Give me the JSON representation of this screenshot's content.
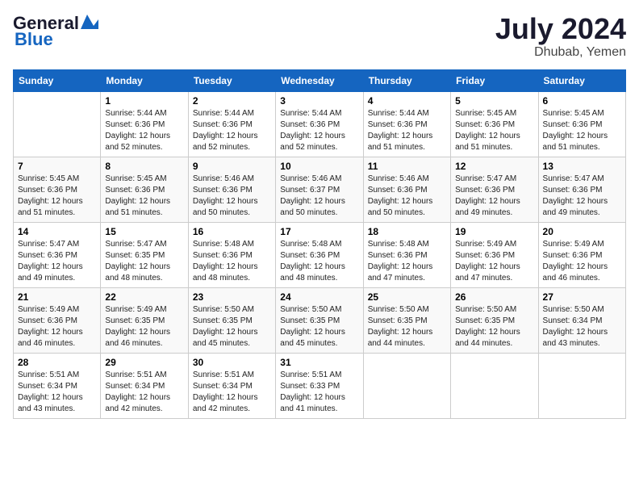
{
  "header": {
    "logo_line1": "General",
    "logo_line2": "Blue",
    "month_year": "July 2024",
    "location": "Dhubab, Yemen"
  },
  "weekdays": [
    "Sunday",
    "Monday",
    "Tuesday",
    "Wednesday",
    "Thursday",
    "Friday",
    "Saturday"
  ],
  "weeks": [
    [
      {
        "day": "",
        "sunrise": "",
        "sunset": "",
        "daylight": ""
      },
      {
        "day": "1",
        "sunrise": "Sunrise: 5:44 AM",
        "sunset": "Sunset: 6:36 PM",
        "daylight": "Daylight: 12 hours and 52 minutes."
      },
      {
        "day": "2",
        "sunrise": "Sunrise: 5:44 AM",
        "sunset": "Sunset: 6:36 PM",
        "daylight": "Daylight: 12 hours and 52 minutes."
      },
      {
        "day": "3",
        "sunrise": "Sunrise: 5:44 AM",
        "sunset": "Sunset: 6:36 PM",
        "daylight": "Daylight: 12 hours and 52 minutes."
      },
      {
        "day": "4",
        "sunrise": "Sunrise: 5:44 AM",
        "sunset": "Sunset: 6:36 PM",
        "daylight": "Daylight: 12 hours and 51 minutes."
      },
      {
        "day": "5",
        "sunrise": "Sunrise: 5:45 AM",
        "sunset": "Sunset: 6:36 PM",
        "daylight": "Daylight: 12 hours and 51 minutes."
      },
      {
        "day": "6",
        "sunrise": "Sunrise: 5:45 AM",
        "sunset": "Sunset: 6:36 PM",
        "daylight": "Daylight: 12 hours and 51 minutes."
      }
    ],
    [
      {
        "day": "7",
        "sunrise": "Sunrise: 5:45 AM",
        "sunset": "Sunset: 6:36 PM",
        "daylight": "Daylight: 12 hours and 51 minutes."
      },
      {
        "day": "8",
        "sunrise": "Sunrise: 5:45 AM",
        "sunset": "Sunset: 6:36 PM",
        "daylight": "Daylight: 12 hours and 51 minutes."
      },
      {
        "day": "9",
        "sunrise": "Sunrise: 5:46 AM",
        "sunset": "Sunset: 6:36 PM",
        "daylight": "Daylight: 12 hours and 50 minutes."
      },
      {
        "day": "10",
        "sunrise": "Sunrise: 5:46 AM",
        "sunset": "Sunset: 6:37 PM",
        "daylight": "Daylight: 12 hours and 50 minutes."
      },
      {
        "day": "11",
        "sunrise": "Sunrise: 5:46 AM",
        "sunset": "Sunset: 6:36 PM",
        "daylight": "Daylight: 12 hours and 50 minutes."
      },
      {
        "day": "12",
        "sunrise": "Sunrise: 5:47 AM",
        "sunset": "Sunset: 6:36 PM",
        "daylight": "Daylight: 12 hours and 49 minutes."
      },
      {
        "day": "13",
        "sunrise": "Sunrise: 5:47 AM",
        "sunset": "Sunset: 6:36 PM",
        "daylight": "Daylight: 12 hours and 49 minutes."
      }
    ],
    [
      {
        "day": "14",
        "sunrise": "Sunrise: 5:47 AM",
        "sunset": "Sunset: 6:36 PM",
        "daylight": "Daylight: 12 hours and 49 minutes."
      },
      {
        "day": "15",
        "sunrise": "Sunrise: 5:47 AM",
        "sunset": "Sunset: 6:35 PM",
        "daylight": "Daylight: 12 hours and 48 minutes."
      },
      {
        "day": "16",
        "sunrise": "Sunrise: 5:48 AM",
        "sunset": "Sunset: 6:36 PM",
        "daylight": "Daylight: 12 hours and 48 minutes."
      },
      {
        "day": "17",
        "sunrise": "Sunrise: 5:48 AM",
        "sunset": "Sunset: 6:36 PM",
        "daylight": "Daylight: 12 hours and 48 minutes."
      },
      {
        "day": "18",
        "sunrise": "Sunrise: 5:48 AM",
        "sunset": "Sunset: 6:36 PM",
        "daylight": "Daylight: 12 hours and 47 minutes."
      },
      {
        "day": "19",
        "sunrise": "Sunrise: 5:49 AM",
        "sunset": "Sunset: 6:36 PM",
        "daylight": "Daylight: 12 hours and 47 minutes."
      },
      {
        "day": "20",
        "sunrise": "Sunrise: 5:49 AM",
        "sunset": "Sunset: 6:36 PM",
        "daylight": "Daylight: 12 hours and 46 minutes."
      }
    ],
    [
      {
        "day": "21",
        "sunrise": "Sunrise: 5:49 AM",
        "sunset": "Sunset: 6:36 PM",
        "daylight": "Daylight: 12 hours and 46 minutes."
      },
      {
        "day": "22",
        "sunrise": "Sunrise: 5:49 AM",
        "sunset": "Sunset: 6:35 PM",
        "daylight": "Daylight: 12 hours and 46 minutes."
      },
      {
        "day": "23",
        "sunrise": "Sunrise: 5:50 AM",
        "sunset": "Sunset: 6:35 PM",
        "daylight": "Daylight: 12 hours and 45 minutes."
      },
      {
        "day": "24",
        "sunrise": "Sunrise: 5:50 AM",
        "sunset": "Sunset: 6:35 PM",
        "daylight": "Daylight: 12 hours and 45 minutes."
      },
      {
        "day": "25",
        "sunrise": "Sunrise: 5:50 AM",
        "sunset": "Sunset: 6:35 PM",
        "daylight": "Daylight: 12 hours and 44 minutes."
      },
      {
        "day": "26",
        "sunrise": "Sunrise: 5:50 AM",
        "sunset": "Sunset: 6:35 PM",
        "daylight": "Daylight: 12 hours and 44 minutes."
      },
      {
        "day": "27",
        "sunrise": "Sunrise: 5:50 AM",
        "sunset": "Sunset: 6:34 PM",
        "daylight": "Daylight: 12 hours and 43 minutes."
      }
    ],
    [
      {
        "day": "28",
        "sunrise": "Sunrise: 5:51 AM",
        "sunset": "Sunset: 6:34 PM",
        "daylight": "Daylight: 12 hours and 43 minutes."
      },
      {
        "day": "29",
        "sunrise": "Sunrise: 5:51 AM",
        "sunset": "Sunset: 6:34 PM",
        "daylight": "Daylight: 12 hours and 42 minutes."
      },
      {
        "day": "30",
        "sunrise": "Sunrise: 5:51 AM",
        "sunset": "Sunset: 6:34 PM",
        "daylight": "Daylight: 12 hours and 42 minutes."
      },
      {
        "day": "31",
        "sunrise": "Sunrise: 5:51 AM",
        "sunset": "Sunset: 6:33 PM",
        "daylight": "Daylight: 12 hours and 41 minutes."
      },
      {
        "day": "",
        "sunrise": "",
        "sunset": "",
        "daylight": ""
      },
      {
        "day": "",
        "sunrise": "",
        "sunset": "",
        "daylight": ""
      },
      {
        "day": "",
        "sunrise": "",
        "sunset": "",
        "daylight": ""
      }
    ]
  ]
}
